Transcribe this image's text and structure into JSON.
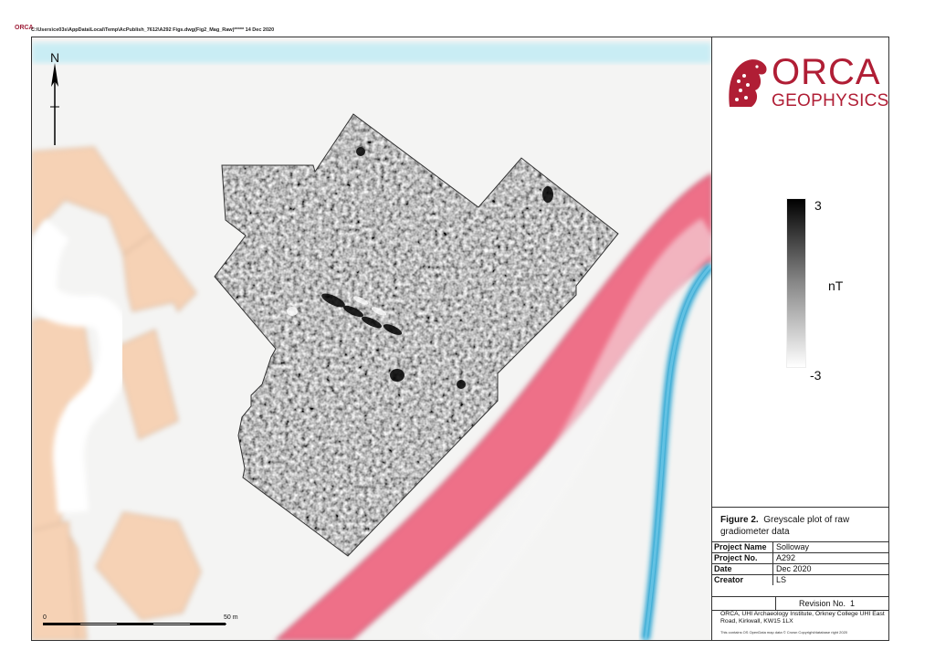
{
  "header": {
    "file_path": "C:\\Users\\ce03s\\AppData\\Local\\Temp\\AcPublish_7612\\A292 Figs.dwg(Fig2_Mag_Raw)***** 14 Dec 2020",
    "small_logo_text": "ORCA"
  },
  "north_arrow": {
    "label": "N"
  },
  "logo": {
    "name": "ORCA",
    "subtitle": "GEOPHYSICS",
    "color": "#b01e35"
  },
  "legend": {
    "max": "3",
    "unit": "nT",
    "min": "-3",
    "gradient": [
      "#000000",
      "#ffffff"
    ]
  },
  "scale_bar": {
    "start": "0",
    "end": "50 m"
  },
  "figure": {
    "number": "Figure 2.",
    "title": "Greyscale plot of raw gradiometer data"
  },
  "project_info": [
    {
      "key": "Project Name",
      "value": "Solloway"
    },
    {
      "key": "Project No.",
      "value": "A292"
    },
    {
      "key": "Date",
      "value": "Dec 2020"
    },
    {
      "key": "Creator",
      "value": "LS"
    }
  ],
  "revision": {
    "label": "Revision No.",
    "value": "1"
  },
  "address": "ORCA, UHI Archaeology Institute, Orkney College UHI East Road, Kirkwall, KW15 1LX",
  "copyright": "This contains OS OpenData map data © Crown Copyright/database right 2020",
  "map_colors": {
    "building": "#f6d2b5",
    "road": "#ee6f88",
    "water": "#22a5cf",
    "water_band": "#c9edf4",
    "background": "#f4f4f3"
  }
}
